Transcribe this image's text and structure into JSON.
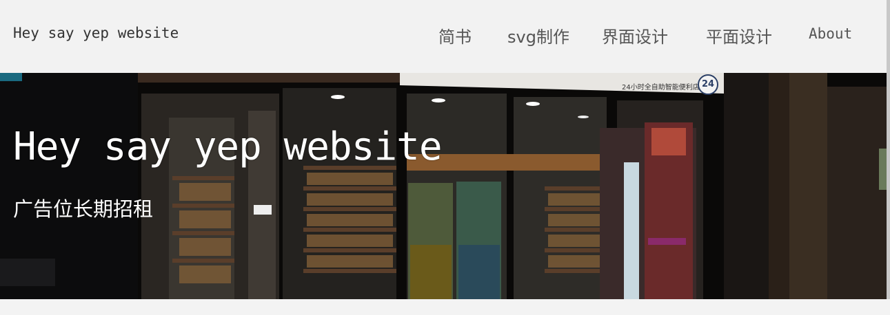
{
  "header": {
    "brand": "Hey say yep website",
    "nav": [
      {
        "label": "简书"
      },
      {
        "label": "svg制作"
      },
      {
        "label": "界面设计"
      },
      {
        "label": "平面设计"
      },
      {
        "label": "About"
      }
    ]
  },
  "hero": {
    "title": "Hey say yep website",
    "subtitle": "广告位长期招租",
    "store_sign_text": "24小时全自助智能便利店",
    "store_badge": "24"
  },
  "colors": {
    "header_bg": "#f2f2f2",
    "hero_overlay": "#0b0a09",
    "text_light": "#ffffff",
    "nav_text": "#555555"
  }
}
